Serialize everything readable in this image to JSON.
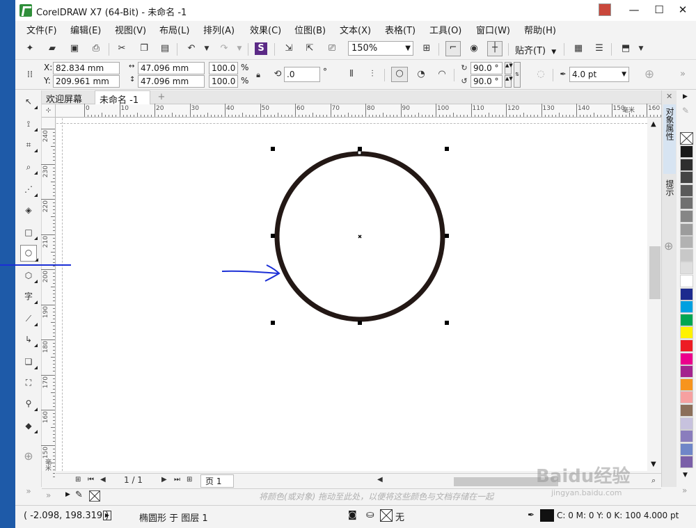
{
  "window": {
    "title": "CorelDRAW X7 (64-Bit) - 未命名 -1",
    "minimize": "—",
    "maximize": "☐",
    "close": "✕"
  },
  "menu": [
    "文件(F)",
    "编辑(E)",
    "视图(V)",
    "布局(L)",
    "排列(A)",
    "效果(C)",
    "位图(B)",
    "文本(X)",
    "表格(T)",
    "工具(O)",
    "窗口(W)",
    "帮助(H)"
  ],
  "toolbar": {
    "zoom": "150%",
    "snap_label": "贴齐(T)"
  },
  "property_bar": {
    "x_label": "X:",
    "x_value": "82.834 mm",
    "y_label": "Y:",
    "y_value": "209.961 mm",
    "width_value": "47.096 mm",
    "height_value": "47.096 mm",
    "scale_w": "100.0",
    "scale_h": "100.0",
    "percent": "%",
    "rotation": ".0",
    "degree_unit": "°",
    "start_angle": "90.0 °",
    "end_angle": "90.0 °",
    "outline_width": "4.0 pt"
  },
  "tabs": {
    "welcome": "欢迎屏幕",
    "document": "未命名 -1",
    "add": "+"
  },
  "ruler": {
    "unit": "毫米",
    "h_labels": [
      "0",
      "10",
      "20",
      "30",
      "40",
      "50",
      "60",
      "70",
      "80",
      "90",
      "100",
      "110",
      "120",
      "130",
      "140",
      "150",
      "160"
    ],
    "v_labels": [
      "240",
      "230",
      "220",
      "210",
      "200",
      "190",
      "180",
      "170",
      "160",
      "150"
    ]
  },
  "page_nav": {
    "counter": "1 / 1",
    "page_tab": "页 1"
  },
  "color_bar": {
    "hint": "将颜色(或对象) 拖动至此处，以便将这些颜色与文档存储在一起"
  },
  "status": {
    "coords": "( -2.098, 198.319 )",
    "object_info": "椭圆形 于 图层 1",
    "fill_none": "无",
    "outline_info": "C: 0 M: 0 Y: 0 K: 100  4.000 pt"
  },
  "docker": {
    "tab1": "对象属性",
    "tab2": "提示"
  },
  "watermark": {
    "brand": "Baidu经验",
    "url": "jingyan.baidu.com"
  },
  "colors": {
    "accent_strip": "#1e5aa8",
    "circle_stroke": "#231815",
    "annotation_blue": "#1b2fd6"
  },
  "palette": [
    "#1a1a1a",
    "#2e2e2e",
    "#444444",
    "#5a5a5a",
    "#707070",
    "#868686",
    "#9c9c9c",
    "#b2b2b2",
    "#c8c8c8",
    "#dedede",
    "#ffffff",
    "#1c2a8e",
    "#00a0e0",
    "#00a651",
    "#fff200",
    "#ed1c24",
    "#ec008c",
    "#a3238e",
    "#f7941d",
    "#f6a0a0",
    "#8b6f5a",
    "#c7c2de",
    "#8a7dbd",
    "#6f86c8",
    "#7a5fa8"
  ]
}
